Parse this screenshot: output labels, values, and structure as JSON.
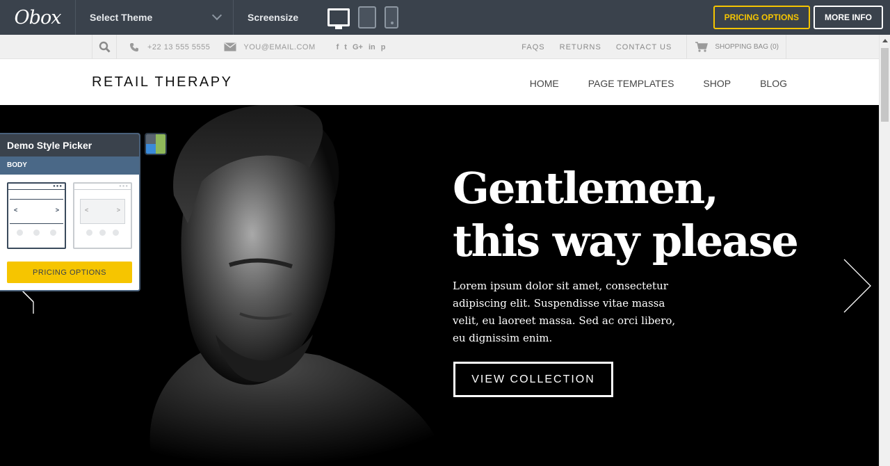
{
  "demo_bar": {
    "logo_text": "Obox",
    "theme_select_label": "Select Theme",
    "screensize_label": "Screensize",
    "devices": [
      "desktop-icon",
      "tablet-icon",
      "phone-icon"
    ],
    "pricing_label": "PRICING OPTIONS",
    "more_info_label": "MORE INFO",
    "colors": {
      "bar": "#3a424c",
      "pricing": "#f6c500",
      "more_info": "#ffffff"
    }
  },
  "info_bar": {
    "phone": "+22 13 555 5555",
    "email": "YOU@EMAIL.COM",
    "socials": [
      "facebook-icon",
      "twitter-icon",
      "google-plus-icon",
      "linkedin-icon",
      "pinterest-icon"
    ],
    "links": [
      "FAQS",
      "RETURNS",
      "CONTACT US"
    ],
    "bag_label": "SHOPPING BAG (0)"
  },
  "header": {
    "site_title": "RETAIL THERAPY",
    "nav": [
      "HOME",
      "PAGE TEMPLATES",
      "SHOP",
      "BLOG"
    ]
  },
  "hero": {
    "title": "Gentlemen, this way please",
    "text": "Lorem ipsum dolor sit amet, consectetur adipiscing elit. Suspendisse vitae massa velit, eu laoreet massa. Sed ac orci libero, eu dignissim enim.",
    "button_label": "VIEW COLLECTION"
  },
  "style_picker": {
    "title": "Demo Style Picker",
    "section": "BODY",
    "layouts": [
      "boxed-layout",
      "wide-layout"
    ],
    "button_label": "PRICING OPTIONS",
    "toggle_colors": [
      "#3b8ad9",
      "#8fb85a"
    ]
  }
}
